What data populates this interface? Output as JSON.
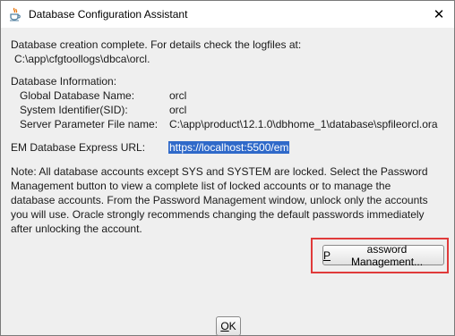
{
  "window": {
    "title": "Database Configuration Assistant",
    "close_glyph": "✕"
  },
  "message": {
    "line1": "Database creation complete. For details check the logfiles at:",
    "line2": "C:\\app\\cfgtoollogs\\dbca\\orcl."
  },
  "db_info": {
    "heading": "Database Information:",
    "rows": [
      {
        "label": "Global Database Name:",
        "value": "orcl"
      },
      {
        "label": "System Identifier(SID):",
        "value": "orcl"
      },
      {
        "label": "Server Parameter File name:",
        "value": "C:\\app\\product\\12.1.0\\dbhome_1\\database\\spfileorcl.ora"
      }
    ]
  },
  "em_url": {
    "label": "EM Database Express URL:",
    "value": "https://localhost:5500/em"
  },
  "note_lines": [
    "Note: All database accounts except SYS and SYSTEM are locked. Select the Password",
    "Management button to view a complete list of locked accounts or to manage the",
    "database accounts. From the Password Management window, unlock only the accounts",
    "you will use. Oracle strongly recommends changing the default passwords immediately",
    "after unlocking the account."
  ],
  "buttons": {
    "password_management": {
      "mnemonic": "P",
      "rest": "assword Management..."
    },
    "ok": {
      "mnemonic": "O",
      "rest": "K"
    }
  },
  "colors": {
    "highlight_bg": "#2f69c9",
    "annotation_frame": "#e03a3a",
    "dialog_bg": "#efefef"
  }
}
